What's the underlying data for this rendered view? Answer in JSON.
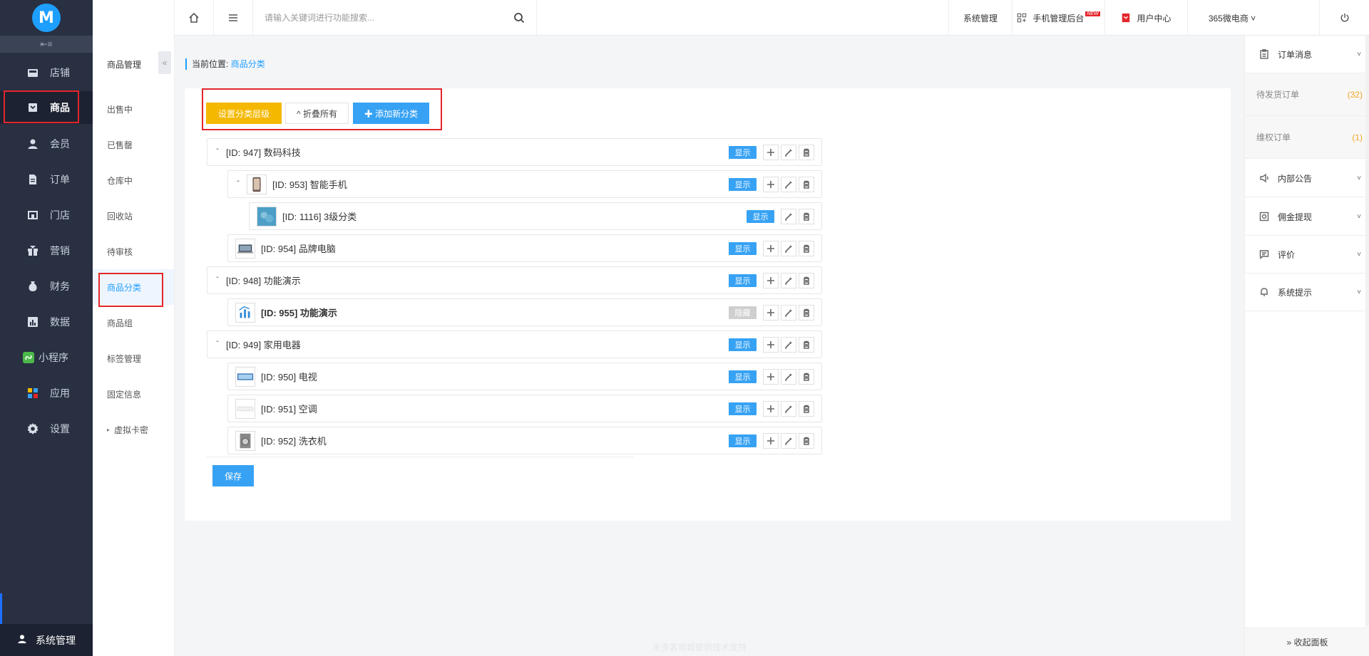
{
  "app": {
    "logo_text": "M",
    "collapse_glyph": "⇤≡"
  },
  "sidebar": {
    "items": [
      {
        "label": "店铺",
        "icon": "store-icon"
      },
      {
        "label": "商品",
        "icon": "goods-icon",
        "active": true
      },
      {
        "label": "会员",
        "icon": "member-icon"
      },
      {
        "label": "订单",
        "icon": "order-icon"
      },
      {
        "label": "门店",
        "icon": "shop-icon"
      },
      {
        "label": "营销",
        "icon": "gift-icon"
      },
      {
        "label": "财务",
        "icon": "money-bag-icon"
      },
      {
        "label": "数据",
        "icon": "data-icon"
      },
      {
        "label": "小程序",
        "icon": "mini-program-icon"
      },
      {
        "label": "应用",
        "icon": "apps-icon"
      },
      {
        "label": "设置",
        "icon": "gear-icon"
      }
    ],
    "bottom_label": "系统管理"
  },
  "submenu": {
    "title": "商品管理",
    "toggle_glyph": "«",
    "items": [
      {
        "label": "出售中"
      },
      {
        "label": "已售罄"
      },
      {
        "label": "仓库中"
      },
      {
        "label": "回收站"
      },
      {
        "label": "待审核"
      },
      {
        "label": "商品分类",
        "active": true
      },
      {
        "label": "商品组"
      },
      {
        "label": "标签管理"
      },
      {
        "label": "固定信息"
      },
      {
        "label": "虚拟卡密",
        "caret": "▸"
      }
    ]
  },
  "header": {
    "search_placeholder": "请输入关键词进行功能搜索...",
    "links": {
      "system": "系统管理",
      "mobile_admin": "手机管理后台",
      "new_badge": "NEW",
      "user_center": "用户中心",
      "shop_name": "365微电商 ˅"
    }
  },
  "breadcrumb": {
    "prefix": "当前位置:",
    "current": "商品分类"
  },
  "toolbar": {
    "set_level": "设置分类层级",
    "collapse_all": "^ 折叠所有",
    "add_new": "✚ 添加新分类"
  },
  "tree": {
    "rows": [
      {
        "toggle": "ˇ",
        "label": "[ID: 947] 数码科技",
        "status": "显示",
        "has_add": true
      },
      {
        "toggle": "ˇ",
        "label": "[ID: 953] 智能手机",
        "status": "显示",
        "has_add": true,
        "thumb": "phone"
      },
      {
        "label": "[ID: 1116] 3级分类",
        "status": "显示",
        "has_add": false,
        "thumb": "blue"
      },
      {
        "label": "[ID: 954] 品牌电脑",
        "status": "显示",
        "has_add": true,
        "thumb": "laptop"
      },
      {
        "toggle": "ˇ",
        "label": "[ID: 948] 功能演示",
        "status": "显示",
        "has_add": true
      },
      {
        "label": "[ID: 955] 功能演示",
        "status": "隐藏",
        "has_add": true,
        "thumb": "chart",
        "bold": true
      },
      {
        "toggle": "ˇ",
        "label": "[ID: 949] 家用电器",
        "status": "显示",
        "has_add": true
      },
      {
        "label": "[ID: 950] 电视",
        "status": "显示",
        "has_add": true,
        "thumb": "tv"
      },
      {
        "label": "[ID: 951] 空调",
        "status": "显示",
        "has_add": true,
        "thumb": "ac"
      },
      {
        "label": "[ID: 952] 洗衣机",
        "status": "显示",
        "has_add": true,
        "thumb": "washer"
      }
    ],
    "save_label": "保存"
  },
  "footer": {
    "text": "米多客商城提供技术支持"
  },
  "right_panel": {
    "sections": {
      "order_msg": "订单消息",
      "pending_ship": "待发货订单",
      "pending_ship_count": "(32)",
      "rights_order": "维权订单",
      "rights_order_count": "(1)",
      "notice": "内部公告",
      "commission": "佣金提现",
      "review": "评价",
      "system_tip": "系统提示"
    },
    "collapse_label": "» 收起面板"
  },
  "colors": {
    "sidebar_bg": "#283042",
    "accent_blue": "#37a2f4",
    "warning_yellow": "#f5b800",
    "highlight_red": "#e4262b"
  }
}
